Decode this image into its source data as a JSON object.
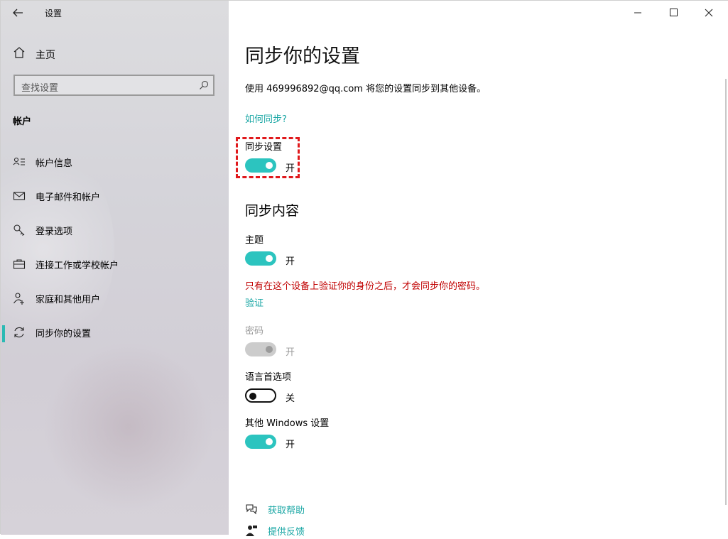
{
  "app": {
    "title": "设置"
  },
  "sidebar": {
    "home_label": "主页",
    "search_placeholder": "查找设置",
    "section": "帐户",
    "items": [
      {
        "label": "帐户信息",
        "icon": "account-info-icon"
      },
      {
        "label": "电子邮件和帐户",
        "icon": "mail-icon"
      },
      {
        "label": "登录选项",
        "icon": "key-icon"
      },
      {
        "label": "连接工作或学校帐户",
        "icon": "briefcase-icon"
      },
      {
        "label": "家庭和其他用户",
        "icon": "person-add-icon"
      },
      {
        "label": "同步你的设置",
        "icon": "sync-icon",
        "active": true
      }
    ]
  },
  "main": {
    "title": "同步你的设置",
    "description": "使用 469996892@qq.com 将您的设置同步到其他设备。",
    "how_link": "如何同步?",
    "sync_settings": {
      "label": "同步设置",
      "state": "开",
      "on": true
    },
    "content_heading": "同步内容",
    "theme": {
      "label": "主题",
      "state": "开",
      "on": true
    },
    "warning": "只有在这个设备上验证你的身份之后，才会同步你的密码。",
    "verify_link": "验证",
    "password": {
      "label": "密码",
      "state": "开",
      "disabled": true
    },
    "language": {
      "label": "语言首选项",
      "state": "关",
      "on": false
    },
    "other": {
      "label": "其他 Windows 设置",
      "state": "开",
      "on": true
    },
    "help": {
      "get_help": "获取帮助",
      "feedback": "提供反馈"
    }
  },
  "colors": {
    "accent": "#2cc4bf",
    "link": "#1ba7a5",
    "warning": "#c00000",
    "highlight": "#e0191c"
  }
}
